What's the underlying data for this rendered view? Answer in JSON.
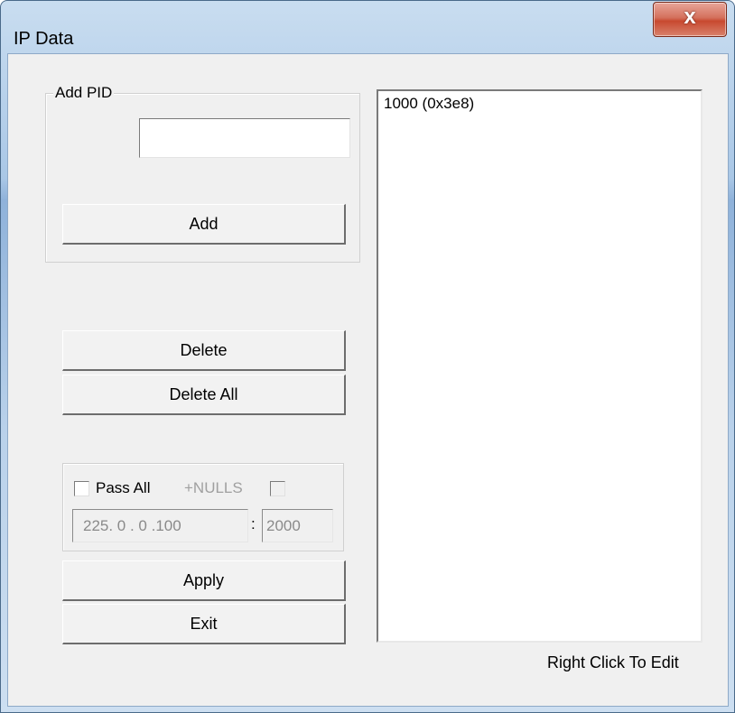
{
  "window": {
    "title": "IP Data",
    "close_glyph": "x"
  },
  "add_pid_group": {
    "label": "Add PID",
    "pid_input_value": "",
    "add_button": "Add"
  },
  "actions": {
    "delete_button": "Delete",
    "delete_all_button": "Delete All"
  },
  "pass_group": {
    "pass_all_label": "Pass All",
    "pass_all_checked": false,
    "nulls_label": "+NULLS",
    "nulls_checked": false,
    "ip_address": "225.  0  .  0  .100",
    "port_separator": ":",
    "port": "2000"
  },
  "footer_buttons": {
    "apply_button": "Apply",
    "exit_button": "Exit"
  },
  "pid_list": {
    "items": [
      "1000 (0x3e8)"
    ],
    "hint": "Right Click To Edit"
  }
}
